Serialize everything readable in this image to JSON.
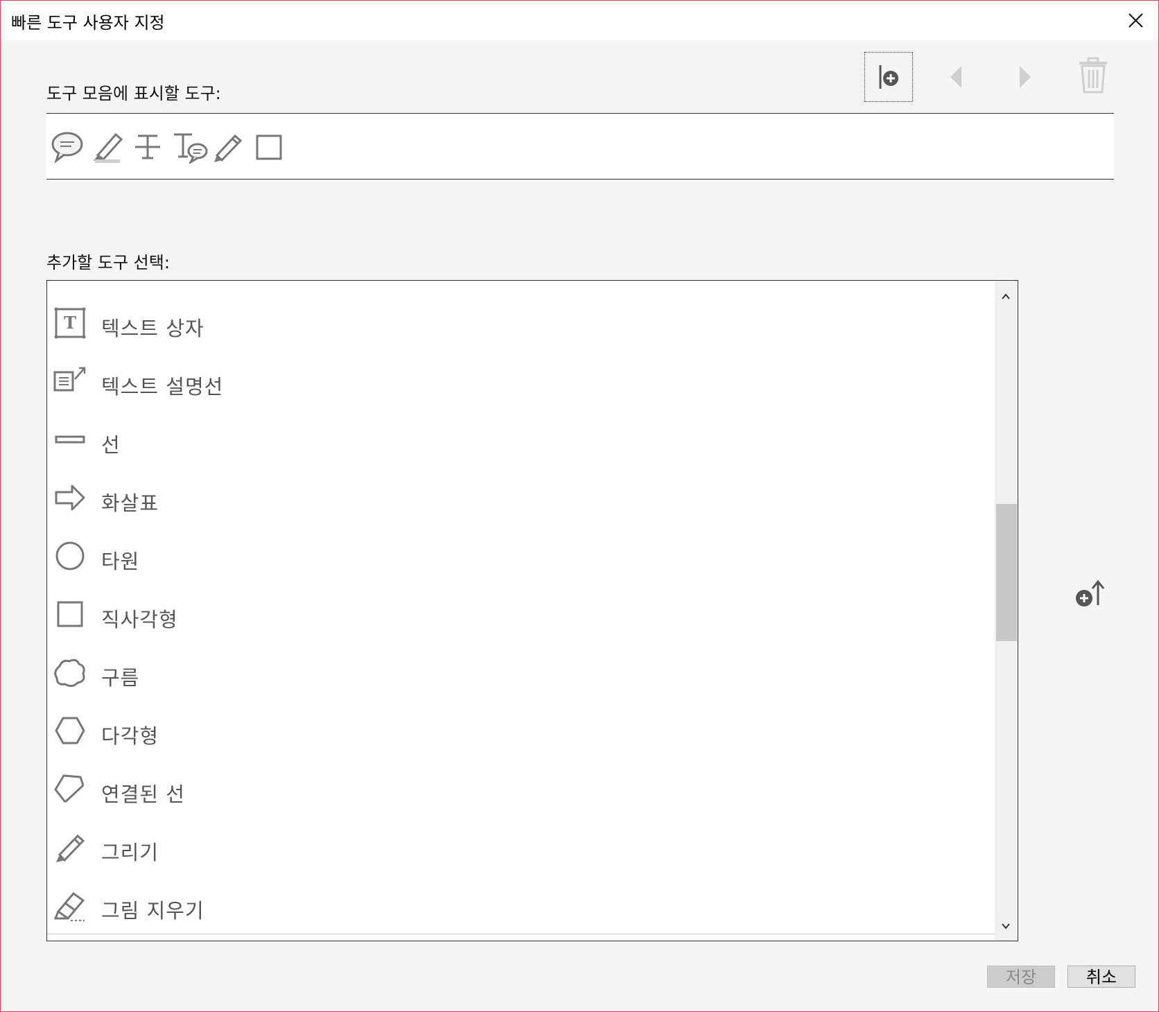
{
  "window": {
    "title": "빠른 도구 사용자 지정"
  },
  "current_tools": {
    "label": "도구 모음에 표시할 도구:",
    "icons": [
      "comment-icon",
      "highlight-icon",
      "strikethrough-text-icon",
      "text-comment-icon",
      "pencil-icon",
      "rectangle-icon"
    ]
  },
  "toolbar": {
    "buttons": [
      "insert-separator-icon",
      "move-left-icon",
      "move-right-icon",
      "delete-icon"
    ]
  },
  "available_tools": {
    "label": "추가할 도구 선택:",
    "items": [
      {
        "label": "텍스트 상자",
        "icon": "text-box-icon"
      },
      {
        "label": "텍스트 설명선",
        "icon": "text-callout-icon"
      },
      {
        "label": "선",
        "icon": "line-icon"
      },
      {
        "label": "화살표",
        "icon": "arrow-icon"
      },
      {
        "label": "타원",
        "icon": "oval-icon"
      },
      {
        "label": "직사각형",
        "icon": "rectangle-icon"
      },
      {
        "label": "구름",
        "icon": "cloud-icon"
      },
      {
        "label": "다각형",
        "icon": "polygon-icon"
      },
      {
        "label": "연결된 선",
        "icon": "connected-lines-icon"
      },
      {
        "label": "그리기",
        "icon": "pencil-icon"
      },
      {
        "label": "그림 지우기",
        "icon": "eraser-icon"
      }
    ]
  },
  "buttons": {
    "save": "저장",
    "cancel": "취소"
  },
  "colors": {
    "border_accent": "#d9404f",
    "icon_gray": "#777777"
  }
}
